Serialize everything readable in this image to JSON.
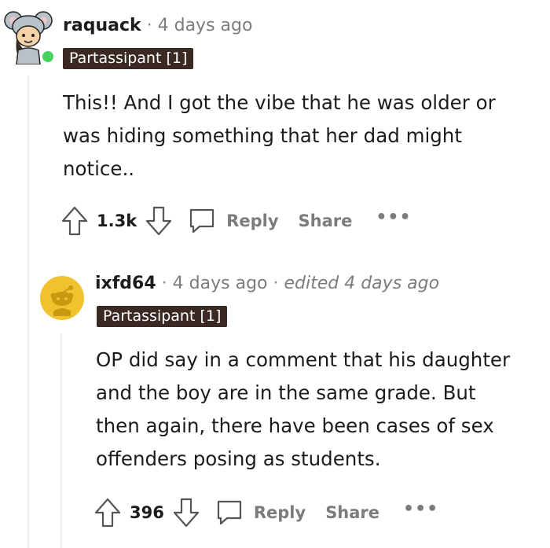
{
  "comments": [
    {
      "username": "raquack",
      "age": "4 days ago",
      "flair": "Partassipant [1]",
      "body": [
        "This!! And I got the vibe that he was older or",
        "was hiding something that her dad might",
        "notice.."
      ],
      "score": "1.3k",
      "reply_label": "Reply",
      "share_label": "Share",
      "more_label": "•••",
      "online_color": "#46d160"
    },
    {
      "username": "ixfd64",
      "age": "4 days ago",
      "edited": "edited 4 days ago",
      "flair": "Partassipant [1]",
      "body": [
        "OP did say in a comment that his daughter",
        "and the boy are in the same grade. But",
        "then again, there have been cases of sex",
        "offenders posing as students."
      ],
      "score": "396",
      "reply_label": "Reply",
      "share_label": "Share",
      "more_label": "•••",
      "avatar_color": "#f2c12e"
    }
  ],
  "separator": "·",
  "colors": {
    "flair_bg": "#3b2a24",
    "muted": "#7c7c7c",
    "thread_line": "#ececec"
  }
}
